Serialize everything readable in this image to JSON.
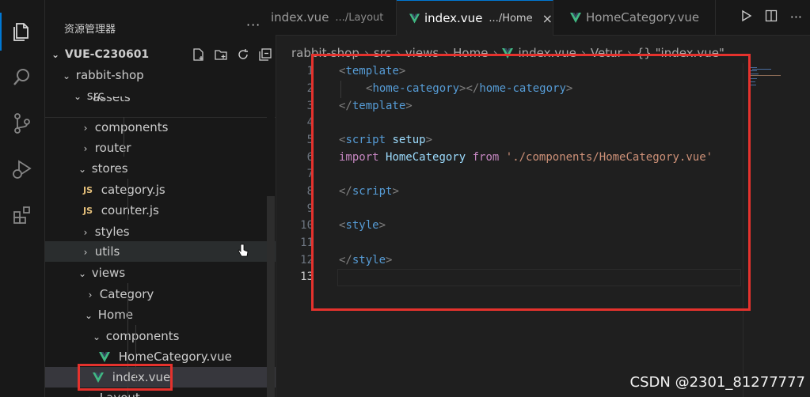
{
  "explorer": {
    "title": "资源管理器",
    "more": "···",
    "root": "VUE-C230601",
    "tree": {
      "rabbit_shop": "rabbit-shop",
      "src": "src",
      "assets": "assets",
      "components": "components",
      "router": "router",
      "stores": "stores",
      "category_js": "category.js",
      "counter_js": "counter.js",
      "styles": "styles",
      "utils": "utils",
      "views": "views",
      "category": "Category",
      "home": "Home",
      "home_components": "components",
      "home_category_vue": "HomeCategory.vue",
      "index_vue": "index.vue",
      "layout": "Layout"
    },
    "js_badge": "JS"
  },
  "tabs": [
    {
      "label": "index.vue",
      "desc": ".../Layout"
    },
    {
      "label": "index.vue",
      "desc": ".../Home",
      "close": "×"
    },
    {
      "label": "HomeCategory.vue"
    }
  ],
  "breadcrumb": [
    "rabbit-shop",
    "src",
    "views",
    "Home",
    "index.vue",
    "Vetur",
    "{} \"index.vue\""
  ],
  "code": {
    "line_numbers": [
      "1",
      "2",
      "3",
      "4",
      "5",
      "6",
      "7",
      "8",
      "9",
      "10",
      "11",
      "12",
      "13"
    ],
    "l1_open": "<",
    "l1_tag": "template",
    "l1_close": ">",
    "l2_open": "<",
    "l2_tag": "home-category",
    "l2_mid": "></",
    "l2_tag2": "home-category",
    "l2_close": ">",
    "l3_open": "</",
    "l3_tag": "template",
    "l3_close": ">",
    "l5_open": "<",
    "l5_tag": "script",
    "l5_attr": "setup",
    "l5_close": ">",
    "l6_kw1": "import",
    "l6_name": "HomeCategory",
    "l6_kw2": "from",
    "l6_str": "'./components/HomeCategory.vue'",
    "l8_open": "</",
    "l8_tag": "script",
    "l8_close": ">",
    "l10_open": "<",
    "l10_tag": "style",
    "l10_close": ">",
    "l12_open": "</",
    "l12_tag": "style",
    "l12_close": ">"
  },
  "watermark": "CSDN @2301_81277777",
  "colors": {
    "accent": "#0078d4",
    "highlight": "#e5322d",
    "vue_green": "#41b883"
  }
}
